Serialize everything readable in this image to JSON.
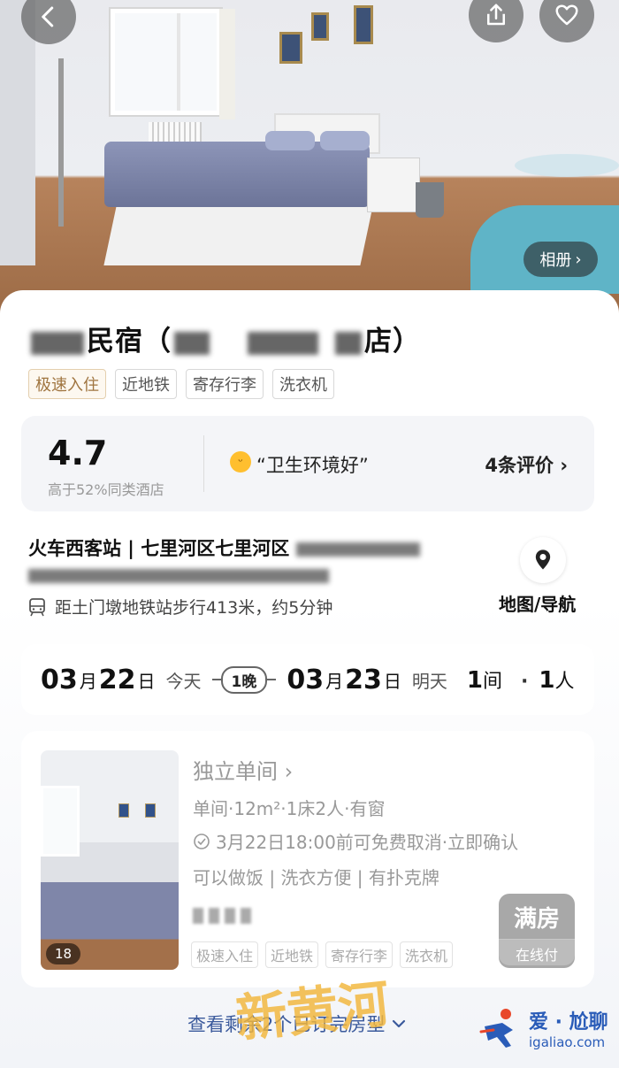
{
  "hero": {
    "album_label": "相册",
    "album_chevron": "›"
  },
  "header": {
    "back_icon": "chevron-left-icon",
    "share_icon": "share-icon",
    "favorite_icon": "heart-icon"
  },
  "hotel": {
    "title_part1": "民宿",
    "title_open": "（",
    "title_tail": "店）",
    "tags": [
      "极速入住",
      "近地铁",
      "寄存行李",
      "洗衣机"
    ]
  },
  "rating": {
    "score": "4.7",
    "subtitle": "高于52%同类酒店",
    "quote": "“卫生环境好”",
    "review_count": "4条评价",
    "review_chevron": "›"
  },
  "location": {
    "address_line1": "火车西客站 | 七里河区七里河区",
    "metro_text": "距土门墩地铁站步行413米，约5分钟",
    "map_label": "地图/导航"
  },
  "booking": {
    "checkin_month": "03",
    "checkin_day": "22",
    "month_unit": "月",
    "day_unit": "日",
    "checkin_label": "今天",
    "nights": "1晚",
    "checkout_month": "03",
    "checkout_day": "23",
    "checkout_label": "明天",
    "rooms": "1",
    "rooms_unit": "间",
    "separator": "·",
    "guests": "1",
    "guests_unit": "人"
  },
  "room": {
    "image_count": "18",
    "name": "独立单间",
    "name_chevron": "›",
    "spec": "单间·12m²·1床2人·有窗",
    "cancel": "3月22日18:00前可免费取消·立即确认",
    "features": "可以做饭 | 洗衣方便 | 有扑克牌",
    "tags": [
      "极速入住",
      "近地铁",
      "寄存行李",
      "洗衣机"
    ],
    "status": "满房",
    "pay_type": "在线付"
  },
  "more": {
    "label": "查看剩余2个已订完房型"
  },
  "watermark": {
    "text": "新黄河"
  },
  "site": {
    "name": "爱 · 尬聊",
    "url": "igaliao.com"
  },
  "colors": {
    "accent_link": "#3b5a9c",
    "tag_gold": "#a07540",
    "full_button": "#a8a8a8"
  }
}
